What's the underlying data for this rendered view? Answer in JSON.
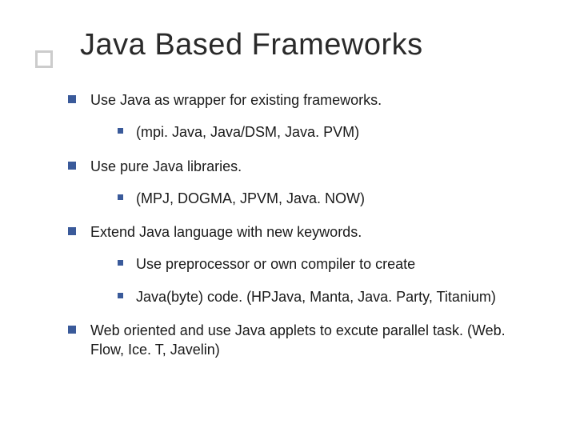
{
  "title": "Java Based Frameworks",
  "items": [
    {
      "text": "Use Java as wrapper for existing frameworks.",
      "sub": [
        {
          "text": "(mpi. Java, Java/DSM, Java. PVM)"
        }
      ]
    },
    {
      "text": "Use pure Java libraries.",
      "sub": [
        {
          "text": "(MPJ, DOGMA, JPVM, Java. NOW)"
        }
      ]
    },
    {
      "text": "Extend Java language with new keywords.",
      "sub": [
        {
          "text": "Use preprocessor or own compiler to create"
        },
        {
          "text": "Java(byte) code.  (HPJava, Manta, Java. Party, Titanium)"
        }
      ]
    },
    {
      "text": "Web oriented and use Java applets to excute parallel task. (Web. Flow, Ice. T, Javelin)",
      "sub": []
    }
  ]
}
